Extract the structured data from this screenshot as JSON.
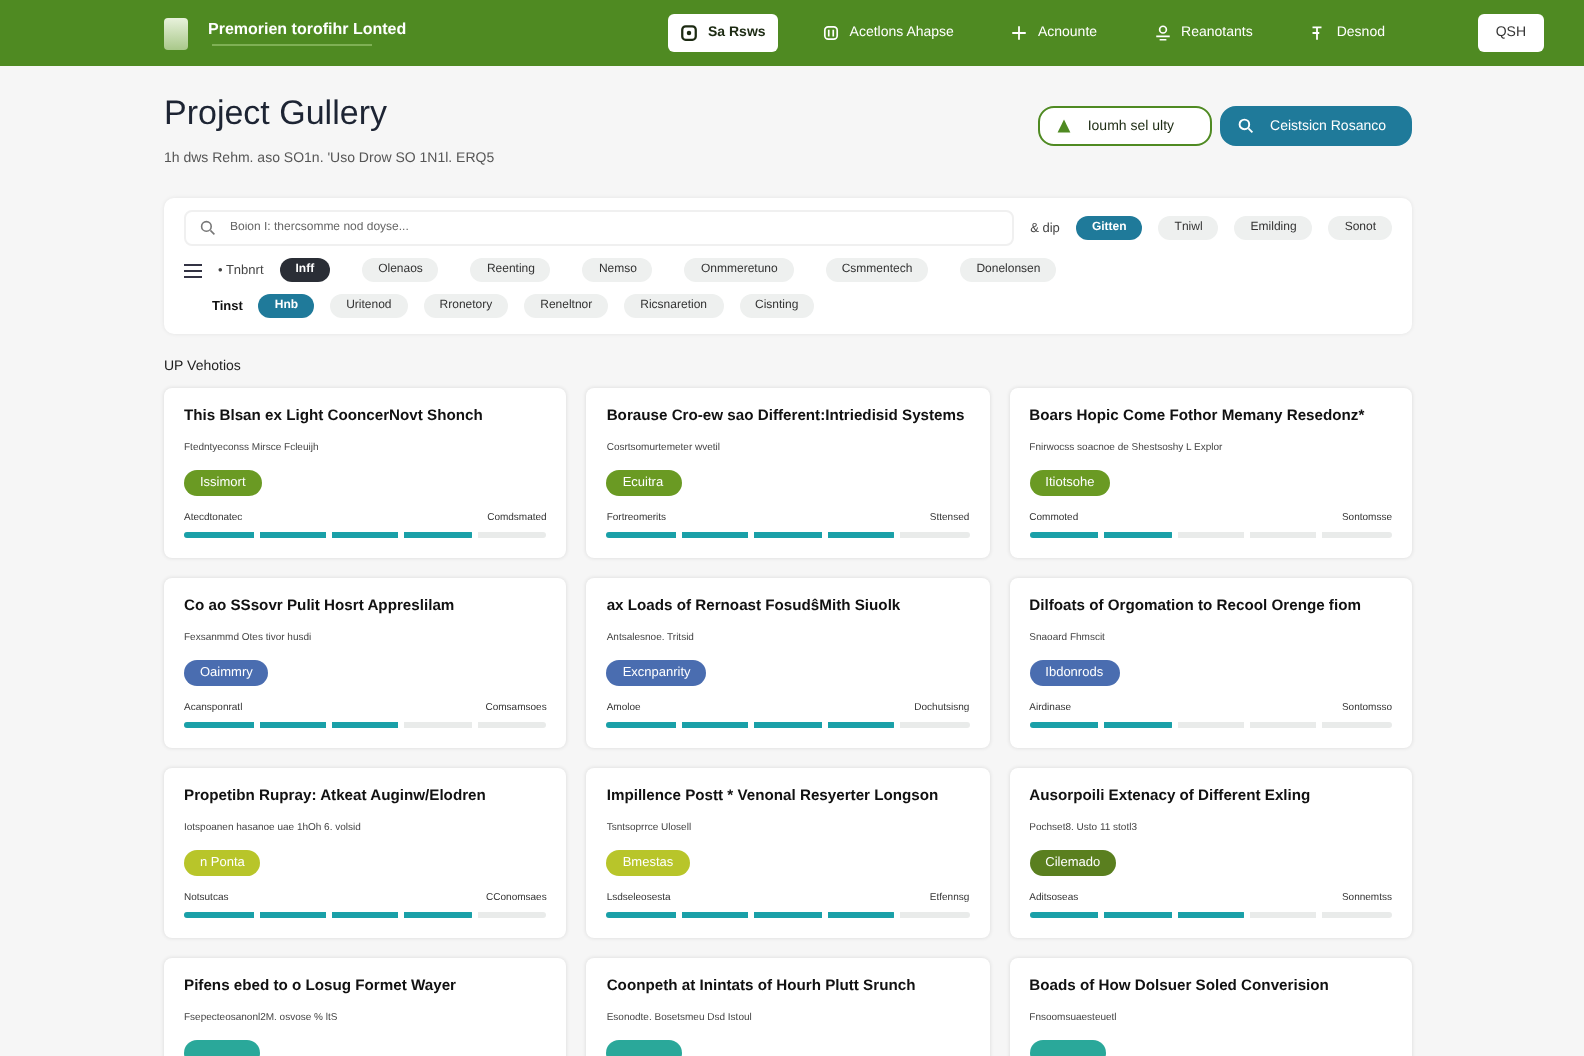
{
  "header": {
    "brand": "Premorien torofihr Lonted",
    "nav": [
      {
        "label": "Sa Rsws",
        "selected": true
      },
      {
        "label": "Acetlons Ahapse",
        "selected": false
      },
      {
        "label": "Acnounte",
        "selected": false
      },
      {
        "label": "Reanotants",
        "selected": false
      },
      {
        "label": "Desnod",
        "selected": false
      }
    ],
    "account": "QSH"
  },
  "page": {
    "title": "Project Gullery",
    "subtitle": "1h dws Rehm. aso SO1n. 'Uso Drow SO 1N1l. ERQ5",
    "actions": [
      {
        "label": "Ioumh sel ulty",
        "kind": "outline"
      },
      {
        "label": "Ceistsicn Rosanco",
        "kind": "primary"
      }
    ]
  },
  "filters": {
    "search": {
      "placeholder": "Boion I: thercsomme nod doyse..."
    },
    "sort_label": "& dip",
    "sort_chips": [
      {
        "label": "Gitten",
        "selected": true
      },
      {
        "label": "Tniwl",
        "selected": false
      },
      {
        "label": "Emilding",
        "selected": false
      },
      {
        "label": "Sonot",
        "selected": false
      }
    ],
    "rows": [
      {
        "label": "• Tnbnrt",
        "kind": "list",
        "chips": [
          {
            "label": "Inff",
            "selected": true
          },
          {
            "label": "Olenaos",
            "selected": false
          },
          {
            "label": "Reenting",
            "selected": false
          },
          {
            "label": "Nemso",
            "selected": false
          },
          {
            "label": "Onmmeretuno",
            "selected": false
          },
          {
            "label": "Csmmentech",
            "selected": false
          },
          {
            "label": "Donelonsen",
            "selected": false
          }
        ]
      },
      {
        "label": "Tinst",
        "kind": "bold",
        "chips": [
          {
            "label": "Hnb",
            "selected": true
          },
          {
            "label": "Uritenod",
            "selected": false
          },
          {
            "label": "Rronetory",
            "selected": false
          },
          {
            "label": "Reneltnor",
            "selected": false
          },
          {
            "label": "Ricsnaretion",
            "selected": false
          },
          {
            "label": "Cisnting",
            "selected": false
          }
        ]
      }
    ]
  },
  "section_title": "UP Vehotios",
  "cards": [
    {
      "title": "This Blsan ex Light CooncerNovt Shonch",
      "subtitle": "Ftedntyeconss Mirsce Fcleuijh",
      "tag": {
        "label": "Issimort",
        "color": "#6a9a23"
      },
      "progress": {
        "left": "Atecdtonatec",
        "right": "Comdsmated",
        "level": 0.8
      }
    },
    {
      "title": "Borause Cro-ew sao Different:Intriedisid Systems",
      "subtitle": "Cosrtsomurtemeter wvetil",
      "tag": {
        "label": "Ecuitra",
        "color": "#6a9a23"
      },
      "progress": {
        "left": "Fortreomerits",
        "right": "Sttensed",
        "level": 0.8
      }
    },
    {
      "title": "Boars Hopic Come Fothor Memany Resedonz*",
      "subtitle": "Fnirwocss soacnoe de Shestsoshy L Explor",
      "tag": {
        "label": "Itiotsohe",
        "color": "#6a9a23"
      },
      "progress": {
        "left": "Commoted",
        "right": "Sontomsse",
        "level": 0.4
      }
    },
    {
      "title": "Co ao SSsovr Pulit Hosrt Appreslilam",
      "subtitle": "Fexsanmmd Otes tivor husdi",
      "tag": {
        "label": "Oaimmry",
        "color": "#4a6db0"
      },
      "progress": {
        "left": "Acansponratl",
        "right": "Comsamsoes",
        "level": 0.6
      }
    },
    {
      "title": "ax Loads of Rernoast FosudŝMith Siuolk",
      "subtitle": "Antsalesnoe. Tritsid",
      "tag": {
        "label": "Excnpanrity",
        "color": "#4a6db0"
      },
      "progress": {
        "left": "Amoloe",
        "right": "Dochutsisng",
        "level": 0.8
      }
    },
    {
      "title": "Dilfoats of Orgomation to Recool Orenge fiom",
      "subtitle": "Snaoard Fhmscit",
      "tag": {
        "label": "Ibdonrods",
        "color": "#4a6db0"
      },
      "progress": {
        "left": "Airdinase",
        "right": "Sontomsso",
        "level": 0.4
      }
    },
    {
      "title": "Propetibn Rupray: Atkeat Auginw/Elodren",
      "subtitle": "Iotspoanen hasanoe uae 1hOh 6. volsid",
      "tag": {
        "label": "n Ponta",
        "color": "#b8c52a"
      },
      "progress": {
        "left": "Notsutcas",
        "right": "CConomsaes",
        "level": 0.8
      }
    },
    {
      "title": "Impillence Postt * Venonal Resyerter Longson",
      "subtitle": "Tsntsoprrce Ulosell",
      "tag": {
        "label": "Bmestas",
        "color": "#b8c52a"
      },
      "progress": {
        "left": "Lsdseleosesta",
        "right": "Etfennsg",
        "level": 0.8
      }
    },
    {
      "title": "Ausorpoili Extenacy of Different Exling",
      "subtitle": "Pochset8. Usto 11 stotl3",
      "tag": {
        "label": "Cilemado",
        "color": "#5a7f1f"
      },
      "progress": {
        "left": "Aditsoseas",
        "right": "Sonnemtss",
        "level": 0.6
      }
    },
    {
      "title": "Pifens ebed to o Losug Formet Wayer",
      "subtitle": "Fsepecteosanonl2M. osvose % ltS",
      "tag": {
        "color": "#2aa89a"
      }
    },
    {
      "title": "Coonpeth at Inintats of Hourh Plutt Srunch",
      "subtitle": "Esonodte. Bosetsmeu Dsd Istoul",
      "tag": {
        "color": "#2aa89a"
      }
    },
    {
      "title": "Boads of How Dolsuer Soled Converision",
      "subtitle": "Fnsoomsuaesteuetl",
      "tag": {
        "color": "#2aa89a"
      }
    }
  ]
}
